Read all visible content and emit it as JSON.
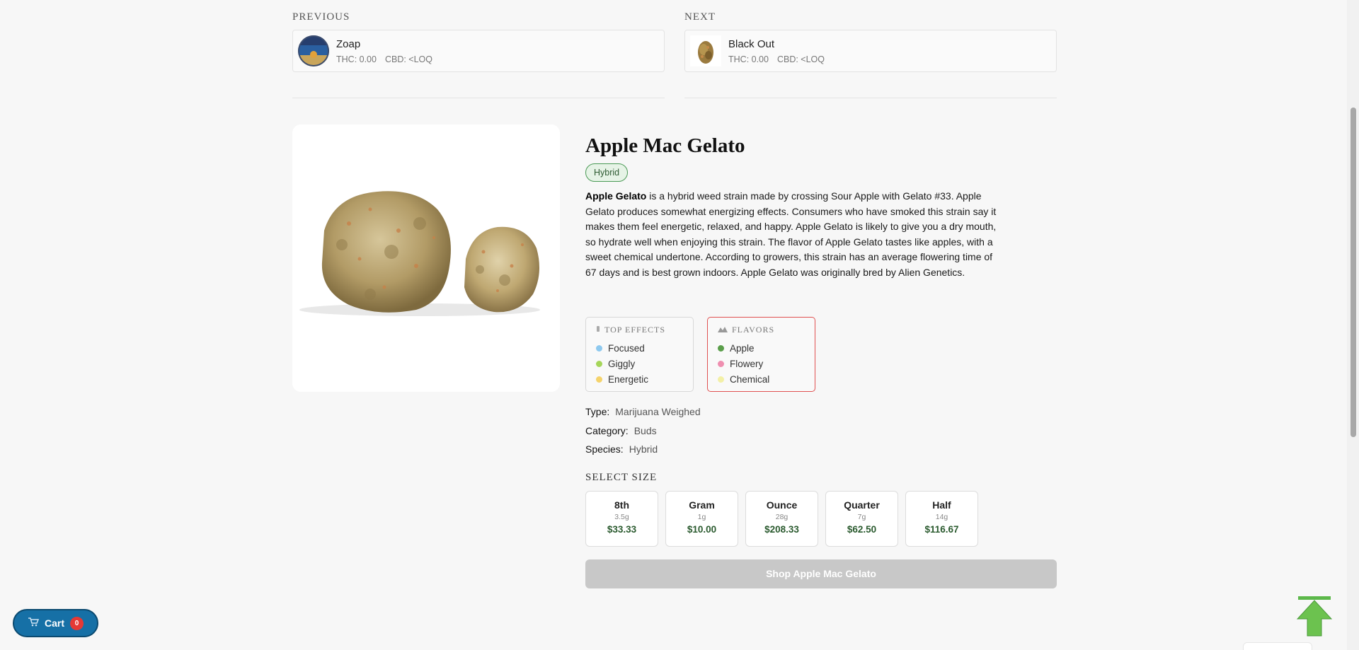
{
  "nav": {
    "previous": {
      "heading": "PREVIOUS",
      "name": "Zoap",
      "thc": "THC: 0.00",
      "cbd": "CBD: <LOQ"
    },
    "next": {
      "heading": "NEXT",
      "name": "Black Out",
      "thc": "THC: 0.00",
      "cbd": "CBD: <LOQ"
    }
  },
  "product": {
    "title": "Apple Mac Gelato",
    "species_badge": "Hybrid",
    "desc_lead": "Apple Gelato",
    "desc_body": " is a hybrid weed strain made by crossing Sour Apple with Gelato #33. Apple Gelato produces somewhat energizing effects. Consumers who have smoked this strain say it makes them feel energetic, relaxed, and happy. Apple Gelato is likely to give you a dry mouth, so hydrate well when enjoying this strain. The flavor of Apple Gelato tastes like apples, with a sweet chemical undertone. According to growers, this strain has an average flowering time of 67 days and is best grown indoors. Apple Gelato was originally bred by Alien Genetics."
  },
  "effects": {
    "heading": "TOP EFFECTS",
    "items": [
      {
        "label": "Focused",
        "color": "#8ec9ef"
      },
      {
        "label": "Giggly",
        "color": "#a6d65a"
      },
      {
        "label": "Energetic",
        "color": "#f5d36b"
      }
    ]
  },
  "flavors": {
    "heading": "FLAVORS",
    "items": [
      {
        "label": "Apple",
        "color": "#5a9e4a"
      },
      {
        "label": "Flowery",
        "color": "#ef8fb0"
      },
      {
        "label": "Chemical",
        "color": "#f3f0a6"
      }
    ]
  },
  "attributes": {
    "type_label": "Type:",
    "type_value": "Marijuana Weighed",
    "category_label": "Category:",
    "category_value": "Buds",
    "species_label": "Species:",
    "species_value": "Hybrid"
  },
  "sizes": {
    "heading": "SELECT SIZE",
    "options": [
      {
        "name": "8th",
        "weight": "3.5g",
        "price": "$33.33"
      },
      {
        "name": "Gram",
        "weight": "1g",
        "price": "$10.00"
      },
      {
        "name": "Ounce",
        "weight": "28g",
        "price": "$208.33"
      },
      {
        "name": "Quarter",
        "weight": "7g",
        "price": "$62.50"
      },
      {
        "name": "Half",
        "weight": "14g",
        "price": "$116.67"
      }
    ]
  },
  "shop_button": "Shop Apple Mac Gelato",
  "cart": {
    "label": "Cart",
    "count": "0"
  },
  "colors": {
    "accent_green": "#2a5a2e",
    "cart_blue": "#1670a6",
    "badge_red": "#e53935",
    "flavors_border": "#e05050"
  },
  "icons": {
    "cart": "cart-icon",
    "scroll_top": "arrow-up-icon",
    "effects": "effects-icon",
    "flavors": "mountain-icon"
  }
}
